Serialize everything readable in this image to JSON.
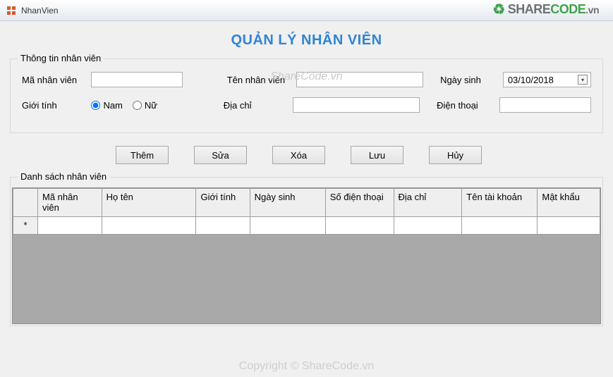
{
  "window": {
    "title": "NhanVien"
  },
  "watermark": {
    "site": "ShareCode.vn",
    "logo_share": "SHARE",
    "logo_code": "CODE",
    "logo_vn": ".vn",
    "footer": "Copyright © ShareCode.vn"
  },
  "page": {
    "title": "QUẢN LÝ NHÂN VIÊN"
  },
  "form": {
    "group_label": "Thông tin nhân viên",
    "ma_nv_label": "Mã nhân viên",
    "ma_nv_value": "",
    "ten_nv_label": "Tên nhân viên",
    "ten_nv_value": "",
    "ngay_sinh_label": "Ngày sinh",
    "ngay_sinh_value": "03/10/2018",
    "gioi_tinh_label": "Giới tính",
    "nam_label": "Nam",
    "nu_label": "Nữ",
    "dia_chi_label": "Địa chỉ",
    "dia_chi_value": "",
    "dien_thoai_label": "Điện thoại",
    "dien_thoai_value": ""
  },
  "buttons": {
    "them": "Thêm",
    "sua": "Sửa",
    "xoa": "Xóa",
    "luu": "Lưu",
    "huy": "Hủy"
  },
  "grid": {
    "group_label": "Danh sách nhân viên",
    "new_row_marker": "*",
    "columns": {
      "ma_nv": "Mã nhân viên",
      "ho_ten": "Họ tên",
      "gioi_tinh": "Giới tính",
      "ngay_sinh": "Ngày sinh",
      "so_dt": "Số điện thoại",
      "dia_chi": "Địa chỉ",
      "tai_khoan": "Tên tài khoản",
      "mat_khau": "Mật khẩu"
    }
  }
}
